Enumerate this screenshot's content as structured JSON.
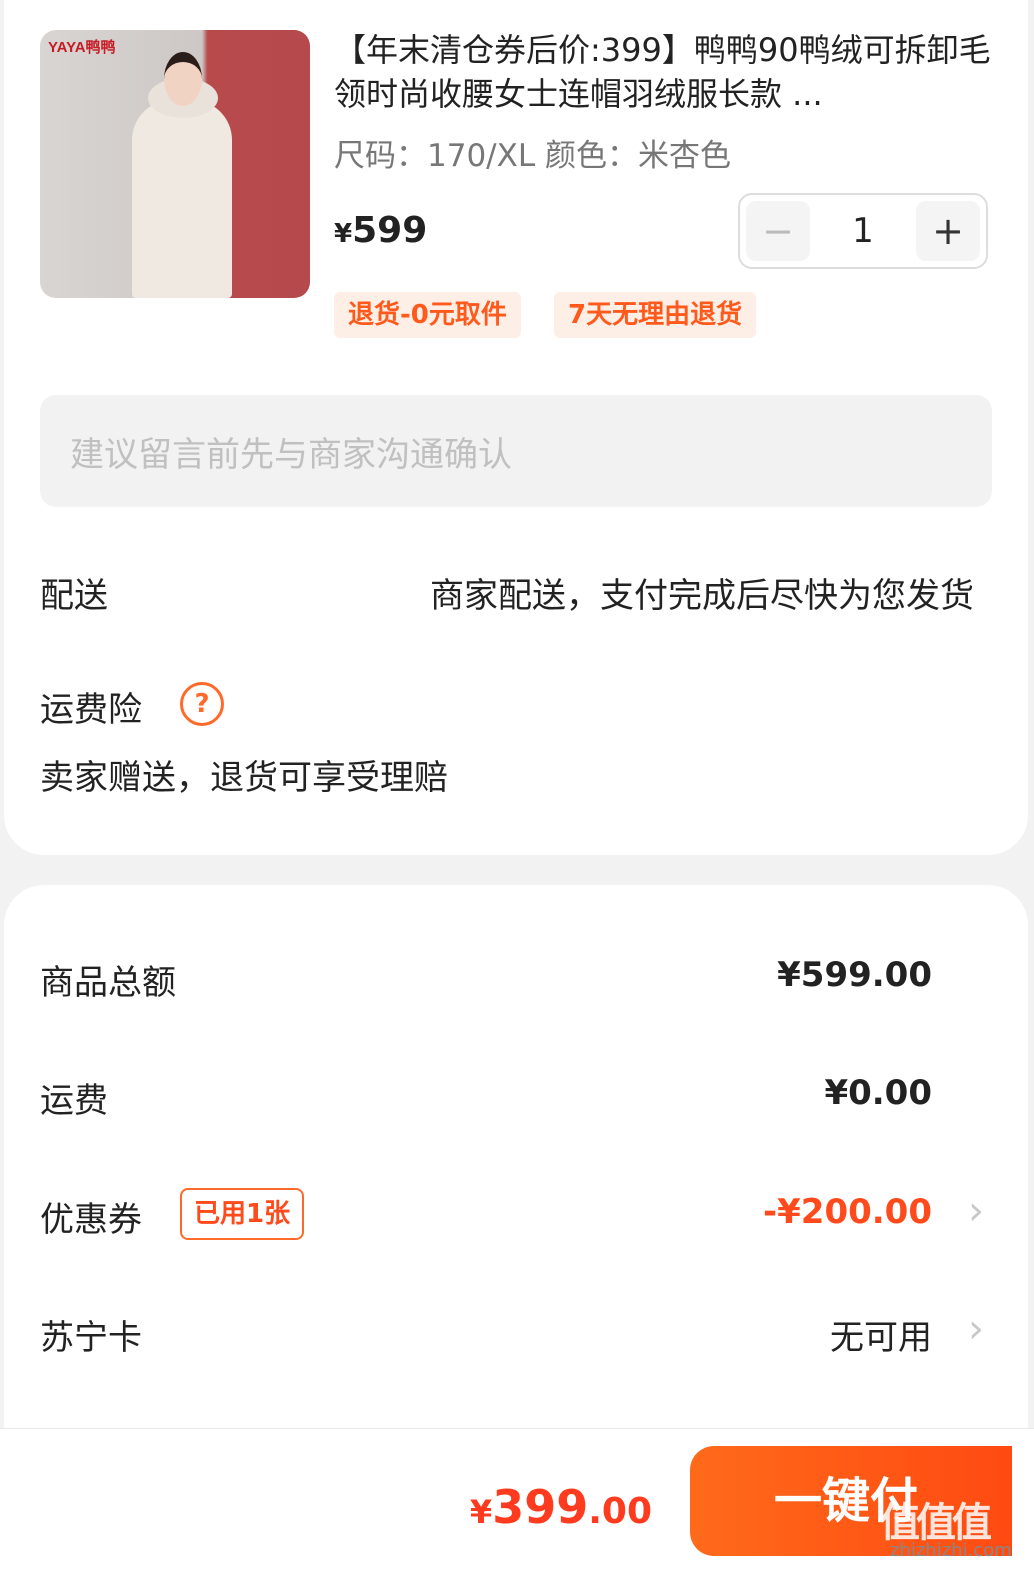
{
  "product": {
    "brand_logo": "YAYA鸭鸭",
    "title": "【年末清仓券后价:399】鸭鸭90鸭绒可拆卸毛领时尚收腰女士连帽羽绒服长款 ...",
    "spec": "尺码：170/XL  颜色：米杏色",
    "price_symbol": "¥",
    "price": "599",
    "quantity": "1",
    "tags": [
      "退货-0元取件",
      "7天无理由退货"
    ]
  },
  "note": {
    "placeholder": "建议留言前先与商家沟通确认"
  },
  "delivery": {
    "label": "配送",
    "value": "商家配送，支付完成后尽快为您发货"
  },
  "shipping_insurance": {
    "label": "运费险",
    "icon": "question-icon",
    "desc": "卖家赠送，退货可享受理赔"
  },
  "summary": {
    "goods_total_label": "商品总额",
    "goods_total": "¥599.00",
    "freight_label": "运费",
    "freight": "¥0.00",
    "coupon_label": "优惠券",
    "coupon_badge": "已用1张",
    "coupon_value": "-¥200.00",
    "card_label": "苏宁卡",
    "card_value": "无可用"
  },
  "footer": {
    "total_symbol": "¥",
    "total_int": "399",
    "total_dec": ".00",
    "buy_label": "一键付"
  },
  "watermark": {
    "text": "值值值",
    "url": "zhizhizhi.com"
  },
  "colors": {
    "accent": "#ff4a12",
    "tag_bg": "#fdeee6"
  }
}
